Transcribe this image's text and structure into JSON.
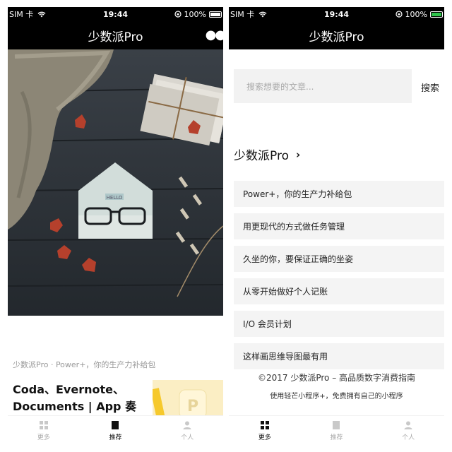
{
  "status": {
    "carrier": "SIM 卡",
    "time": "19:44",
    "battery": "100%"
  },
  "app_title": "少数派Pro",
  "left": {
    "caption": "少数派Pro · Power+，你的生产力补给包",
    "headline": "Coda、Evernote、Documents | App 奏折",
    "hero_card_text": "HELLO",
    "thumb_letter": "P",
    "tabs": [
      {
        "label": "更多",
        "icon": "grid-icon",
        "active": false
      },
      {
        "label": "推荐",
        "icon": "recommend-icon",
        "active": true
      },
      {
        "label": "个人",
        "icon": "person-icon",
        "active": false
      }
    ]
  },
  "right": {
    "search_placeholder": "搜索想要的文章...",
    "search_button": "搜索",
    "section_title": "少数派Pro",
    "section_chevron": "›",
    "list": [
      "Power+，你的生产力补给包",
      "用更现代的方式做任务管理",
      "久坐的你，要保证正确的坐姿",
      "从零开始做好个人记账",
      "I/O 会员计划",
      "这样画思维导图最有用"
    ],
    "footer_line1": "©2017 少数派Pro – 高品质数字消费指南",
    "footer_line2": "使用轻芒小程序+，免费拥有自己的小程序",
    "tabs": [
      {
        "label": "更多",
        "icon": "grid-icon",
        "active": true
      },
      {
        "label": "推荐",
        "icon": "recommend-icon",
        "active": false
      },
      {
        "label": "个人",
        "icon": "person-icon",
        "active": false
      }
    ]
  },
  "colors": {
    "bar": "#000000",
    "active_tab": "#111111",
    "inactive_tab": "#aaaaaa",
    "battery_green": "#2fc44b"
  }
}
